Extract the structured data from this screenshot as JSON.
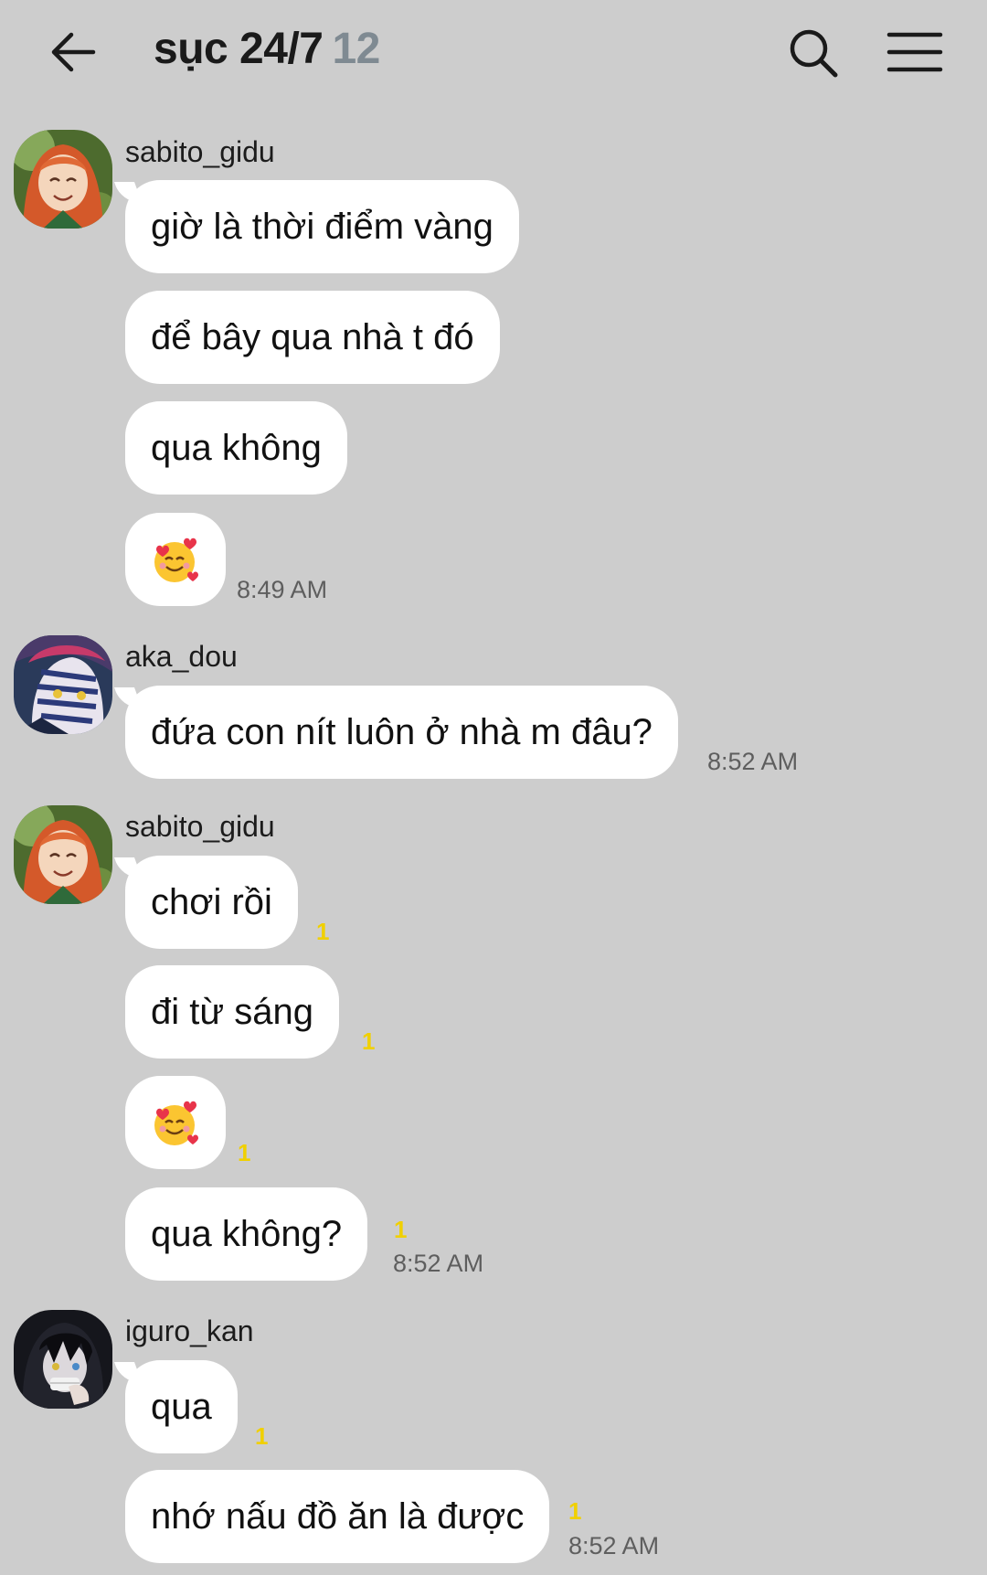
{
  "header": {
    "title": "sục 24/7",
    "member_count": "12",
    "back_icon": "arrow-left-icon",
    "search_icon": "search-icon",
    "menu_icon": "hamburger-menu-icon"
  },
  "messages": {
    "group1": {
      "sender": "sabito_gidu",
      "m1": "giờ là thời điểm vàng",
      "m2": "để bây qua nhà t đó",
      "m3": "qua không",
      "m4_emoji": "smiling-face-with-hearts-emoji",
      "time": "8:49 AM"
    },
    "group2": {
      "sender": "aka_dou",
      "m1": "đứa con nít luôn ở nhà m đâu?",
      "time": "8:52 AM"
    },
    "group3": {
      "sender": "sabito_gidu",
      "m1": "chơi rồi",
      "m1_unread": "1",
      "m2": "đi từ sáng",
      "m2_unread": "1",
      "m3_emoji": "smiling-face-with-hearts-emoji",
      "m3_unread": "1",
      "m4": "qua không?",
      "m4_unread": "1",
      "time": "8:52 AM"
    },
    "group4": {
      "sender": "iguro_kan",
      "m1": "qua",
      "m1_unread": "1",
      "m2": "nhớ nấu đồ ăn là được",
      "m2_unread": "1",
      "time": "8:52 AM"
    }
  },
  "colors": {
    "background": "#cdcdcd",
    "bubble": "#ffffff",
    "unread": "#f0d000",
    "member_count": "#7f8a92"
  }
}
